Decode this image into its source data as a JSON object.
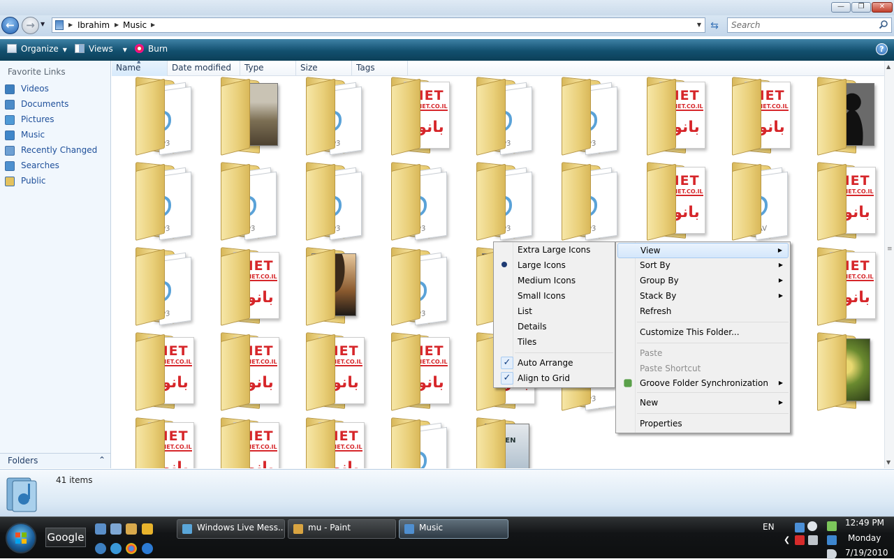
{
  "window": {
    "minimize_glyph": "—",
    "maximize_glyph": "❐",
    "close_glyph": "✕"
  },
  "address": {
    "crumbs": [
      "Ibrahim",
      "Music"
    ],
    "search_placeholder": "Search"
  },
  "toolbar": {
    "organize_label": "Organize",
    "views_label": "Views",
    "burn_label": "Burn",
    "help_label": "?"
  },
  "navpane": {
    "title": "Favorite Links",
    "links": [
      {
        "label": "Videos",
        "icon": "videos-icon",
        "color": "#3c7fbf"
      },
      {
        "label": "Documents",
        "icon": "documents-icon",
        "color": "#4b8bc8"
      },
      {
        "label": "Pictures",
        "icon": "pictures-icon",
        "color": "#4f9ad6"
      },
      {
        "label": "Music",
        "icon": "music-icon",
        "color": "#3f86c9"
      },
      {
        "label": "Recently Changed",
        "icon": "recently-changed-icon",
        "color": "#6ea0d3"
      },
      {
        "label": "Searches",
        "icon": "searches-icon",
        "color": "#4d90cf"
      },
      {
        "label": "Public",
        "icon": "public-folder-icon",
        "color": "#e4c25e"
      }
    ],
    "folders_label": "Folders"
  },
  "columns": [
    "Name",
    "Date modified",
    "Type",
    "Size",
    "Tags"
  ],
  "folders": [
    {
      "kind": "mp3"
    },
    {
      "kind": "album-brown"
    },
    {
      "kind": "mp3"
    },
    {
      "kind": "panet"
    },
    {
      "kind": "mp3"
    },
    {
      "kind": "mp3"
    },
    {
      "kind": "panet"
    },
    {
      "kind": "panet"
    },
    {
      "kind": "silhouette"
    },
    {
      "kind": "mp3"
    },
    {
      "kind": "mp3"
    },
    {
      "kind": "mp3"
    },
    {
      "kind": "mp3"
    },
    {
      "kind": "mp3"
    },
    {
      "kind": "mp3"
    },
    {
      "kind": "panet"
    },
    {
      "kind": "wav"
    },
    {
      "kind": "panet"
    },
    {
      "kind": "mp3"
    },
    {
      "kind": "panet"
    },
    {
      "kind": "album-hat"
    },
    {
      "kind": "mp3"
    },
    {
      "kind": "album-dark"
    },
    {
      "kind": "hidden"
    },
    {
      "kind": "hidden"
    },
    {
      "kind": "hidden"
    },
    {
      "kind": "panet"
    },
    {
      "kind": "panet"
    },
    {
      "kind": "panet"
    },
    {
      "kind": "panet"
    },
    {
      "kind": "panet"
    },
    {
      "kind": "panet"
    },
    {
      "kind": "mp3"
    },
    {
      "kind": "hidden"
    },
    {
      "kind": "hidden"
    },
    {
      "kind": "album-green"
    },
    {
      "kind": "panet"
    },
    {
      "kind": "panet"
    },
    {
      "kind": "panet"
    },
    {
      "kind": "mp3"
    },
    {
      "kind": "album-beethoven"
    }
  ],
  "folder_art": {
    "panet_title": "ANET",
    "panet_url": "W.PANET.CO.IL",
    "panet_arabic": "بانورا",
    "mp3_label": "P3",
    "wav_label": "AV",
    "beethoven_text": "HOVEN"
  },
  "details": {
    "item_count": "41 items"
  },
  "view_submenu": {
    "items": [
      {
        "label": "Extra Large Icons",
        "mark": ""
      },
      {
        "label": "Large Icons",
        "mark": "bullet"
      },
      {
        "label": "Medium Icons",
        "mark": ""
      },
      {
        "label": "Small Icons",
        "mark": ""
      },
      {
        "label": "List",
        "mark": ""
      },
      {
        "label": "Details",
        "mark": ""
      },
      {
        "label": "Tiles",
        "mark": ""
      },
      {
        "label": "Auto Arrange",
        "mark": "check"
      },
      {
        "label": "Align to Grid",
        "mark": "check"
      }
    ],
    "check_glyph": "✓"
  },
  "context_menu": {
    "items": [
      {
        "label": "View",
        "arrow": true,
        "highlighted": true
      },
      {
        "label": "Sort By",
        "arrow": true
      },
      {
        "label": "Group By",
        "arrow": true
      },
      {
        "label": "Stack By",
        "arrow": true
      },
      {
        "label": "Refresh"
      },
      {
        "label": "Customize This Folder..."
      },
      {
        "label": "Paste",
        "disabled": true
      },
      {
        "label": "Paste Shortcut",
        "disabled": true
      },
      {
        "label": "Groove Folder Synchronization",
        "arrow": true,
        "icon": "groove-icon"
      },
      {
        "label": "New",
        "arrow": true
      },
      {
        "label": "Properties"
      }
    ]
  },
  "taskbar": {
    "google_label": "Google",
    "tasks": [
      {
        "label": "Windows Live Mess...",
        "icon": "messenger-icon",
        "color": "#5aa6d9"
      },
      {
        "label": "mu - Paint",
        "icon": "paint-icon",
        "color": "#d9a441"
      },
      {
        "label": "Music",
        "icon": "music-folder-icon",
        "color": "#4f8fd0",
        "active": true
      }
    ],
    "language": "EN",
    "time": "12:49 PM",
    "day": "Monday",
    "date": "7/19/2010"
  }
}
